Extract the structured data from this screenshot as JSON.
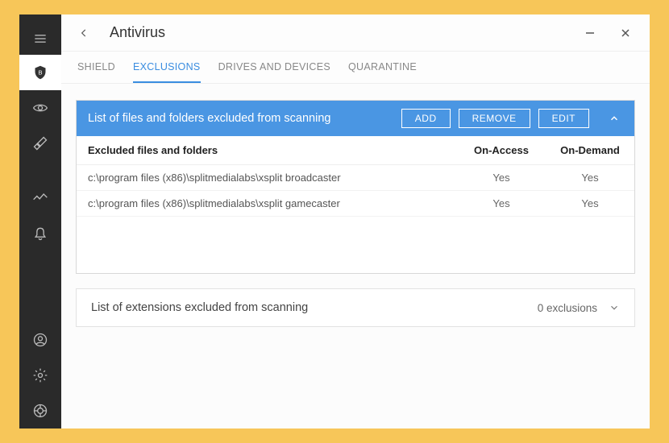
{
  "title": "Antivirus",
  "tabs": [
    {
      "label": "SHIELD",
      "active": false
    },
    {
      "label": "EXCLUSIONS",
      "active": true
    },
    {
      "label": "DRIVES AND DEVICES",
      "active": false
    },
    {
      "label": "QUARANTINE",
      "active": false
    }
  ],
  "panel1": {
    "title": "List of files and folders excluded from scanning",
    "buttons": {
      "add": "ADD",
      "remove": "REMOVE",
      "edit": "EDIT"
    },
    "columns": {
      "c1": "Excluded files and folders",
      "c2": "On-Access",
      "c3": "On-Demand"
    },
    "rows": [
      {
        "path": "c:\\program files (x86)\\splitmedialabs\\xsplit broadcaster",
        "onaccess": "Yes",
        "ondemand": "Yes"
      },
      {
        "path": "c:\\program files (x86)\\splitmedialabs\\xsplit gamecaster",
        "onaccess": "Yes",
        "ondemand": "Yes"
      }
    ]
  },
  "panel2": {
    "title": "List of extensions excluded from scanning",
    "count_label": "0 exclusions"
  }
}
